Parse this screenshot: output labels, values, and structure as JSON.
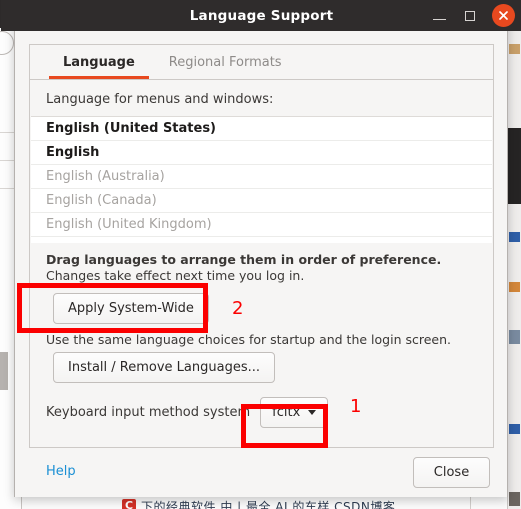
{
  "window": {
    "title": "Language Support",
    "controls": {
      "minimize": "minimize-icon",
      "maximize": "maximize-icon",
      "close": "close-icon"
    },
    "accent_color": "#E8491F",
    "titlebar_color": "#2F2C2C"
  },
  "tabs": [
    {
      "label": "Language",
      "active": true
    },
    {
      "label": "Regional Formats",
      "active": false
    }
  ],
  "language_tab": {
    "list_label": "Language for menus and windows:",
    "languages": [
      {
        "name": "English (United States)",
        "enabled": true
      },
      {
        "name": "English",
        "enabled": true
      },
      {
        "name": "English (Australia)",
        "enabled": false
      },
      {
        "name": "English (Canada)",
        "enabled": false
      },
      {
        "name": "English (United Kingdom)",
        "enabled": false
      }
    ],
    "hint_bold": "Drag languages to arrange them in order of preference.",
    "hint_normal": "Changes take effect next time you log in.",
    "apply_button": "Apply System-Wide",
    "apply_note": "Use the same language choices for startup and the login screen.",
    "install_button": "Install / Remove Languages...",
    "ime_label": "Keyboard input method system",
    "ime_value": "fcitx",
    "ime_caret": "chevron-down-icon"
  },
  "footer": {
    "help": "Help",
    "close": "Close"
  },
  "annotations": {
    "marker_one": "1",
    "marker_two": "2",
    "color": "#FB0000"
  },
  "background": {
    "badge": "C",
    "strip_text": "下的经典软件 中 | 最全 AI 的车样 CSDN博客"
  }
}
